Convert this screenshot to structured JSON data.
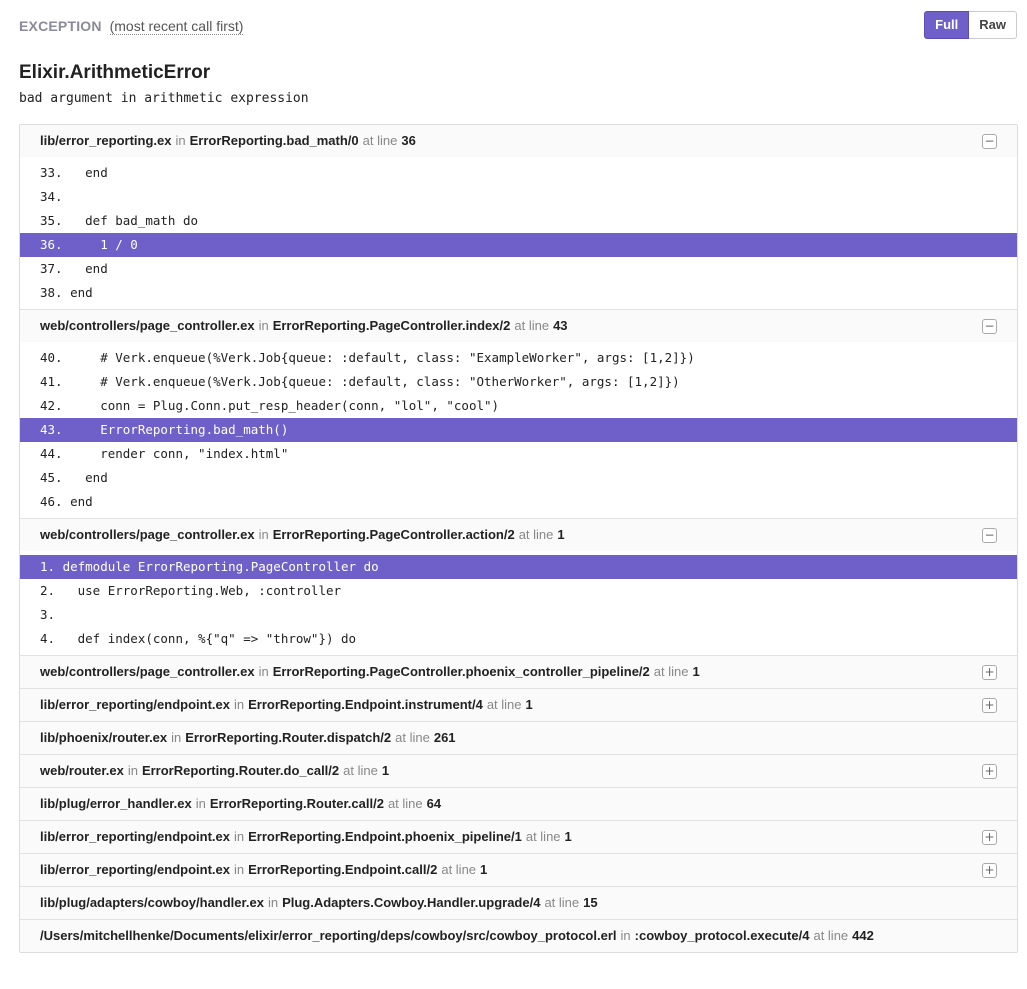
{
  "header": {
    "label": "EXCEPTION",
    "hint": "(most recent call first)",
    "full_label": "Full",
    "raw_label": "Raw"
  },
  "error": {
    "title": "Elixir.ArithmeticError",
    "message": "bad argument in arithmetic expression"
  },
  "frames": [
    {
      "file": "lib/error_reporting.ex",
      "in": "in",
      "mod": "ErrorReporting.bad_math/0",
      "at": "at line",
      "line": "36",
      "expander": "−",
      "code": [
        {
          "text": "33.   end",
          "hl": false
        },
        {
          "text": "34.",
          "hl": false
        },
        {
          "text": "35.   def bad_math do",
          "hl": false
        },
        {
          "text": "36.     1 / 0",
          "hl": true
        },
        {
          "text": "37.   end",
          "hl": false
        },
        {
          "text": "38. end",
          "hl": false
        }
      ]
    },
    {
      "file": "web/controllers/page_controller.ex",
      "in": "in",
      "mod": "ErrorReporting.PageController.index/2",
      "at": "at line",
      "line": "43",
      "expander": "−",
      "code": [
        {
          "text": "40.     # Verk.enqueue(%Verk.Job{queue: :default, class: \"ExampleWorker\", args: [1,2]})",
          "hl": false
        },
        {
          "text": "41.     # Verk.enqueue(%Verk.Job{queue: :default, class: \"OtherWorker\", args: [1,2]})",
          "hl": false
        },
        {
          "text": "42.     conn = Plug.Conn.put_resp_header(conn, \"lol\", \"cool\")",
          "hl": false
        },
        {
          "text": "43.     ErrorReporting.bad_math()",
          "hl": true
        },
        {
          "text": "44.     render conn, \"index.html\"",
          "hl": false
        },
        {
          "text": "45.   end",
          "hl": false
        },
        {
          "text": "46. end",
          "hl": false
        }
      ]
    },
    {
      "file": "web/controllers/page_controller.ex",
      "in": "in",
      "mod": "ErrorReporting.PageController.action/2",
      "at": "at line",
      "line": "1",
      "expander": "−",
      "code": [
        {
          "text": "1. defmodule ErrorReporting.PageController do",
          "hl": true
        },
        {
          "text": "2.   use ErrorReporting.Web, :controller",
          "hl": false
        },
        {
          "text": "3.",
          "hl": false
        },
        {
          "text": "4.   def index(conn, %{\"q\" => \"throw\"}) do",
          "hl": false
        }
      ]
    },
    {
      "file": "web/controllers/page_controller.ex",
      "in": "in",
      "mod": "ErrorReporting.PageController.phoenix_controller_pipeline/2",
      "at": "at line",
      "line": "1",
      "expander": "+"
    },
    {
      "file": "lib/error_reporting/endpoint.ex",
      "in": "in",
      "mod": "ErrorReporting.Endpoint.instrument/4",
      "at": "at line",
      "line": "1",
      "expander": "+"
    },
    {
      "file": "lib/phoenix/router.ex",
      "in": "in",
      "mod": "ErrorReporting.Router.dispatch/2",
      "at": "at line",
      "line": "261",
      "expander": ""
    },
    {
      "file": "web/router.ex",
      "in": "in",
      "mod": "ErrorReporting.Router.do_call/2",
      "at": "at line",
      "line": "1",
      "expander": "+"
    },
    {
      "file": "lib/plug/error_handler.ex",
      "in": "in",
      "mod": "ErrorReporting.Router.call/2",
      "at": "at line",
      "line": "64",
      "expander": ""
    },
    {
      "file": "lib/error_reporting/endpoint.ex",
      "in": "in",
      "mod": "ErrorReporting.Endpoint.phoenix_pipeline/1",
      "at": "at line",
      "line": "1",
      "expander": "+"
    },
    {
      "file": "lib/error_reporting/endpoint.ex",
      "in": "in",
      "mod": "ErrorReporting.Endpoint.call/2",
      "at": "at line",
      "line": "1",
      "expander": "+"
    },
    {
      "file": "lib/plug/adapters/cowboy/handler.ex",
      "in": "in",
      "mod": "Plug.Adapters.Cowboy.Handler.upgrade/4",
      "at": "at line",
      "line": "15",
      "expander": ""
    },
    {
      "file": "/Users/mitchellhenke/Documents/elixir/error_reporting/deps/cowboy/src/cowboy_protocol.erl",
      "in": "in",
      "mod": ":cowboy_protocol.execute/4",
      "at": "at line",
      "line": "442",
      "expander": ""
    }
  ],
  "colors": {
    "accent": "#6f5fc8",
    "header_bg": "#fafafa",
    "border": "#dcdcdc"
  }
}
